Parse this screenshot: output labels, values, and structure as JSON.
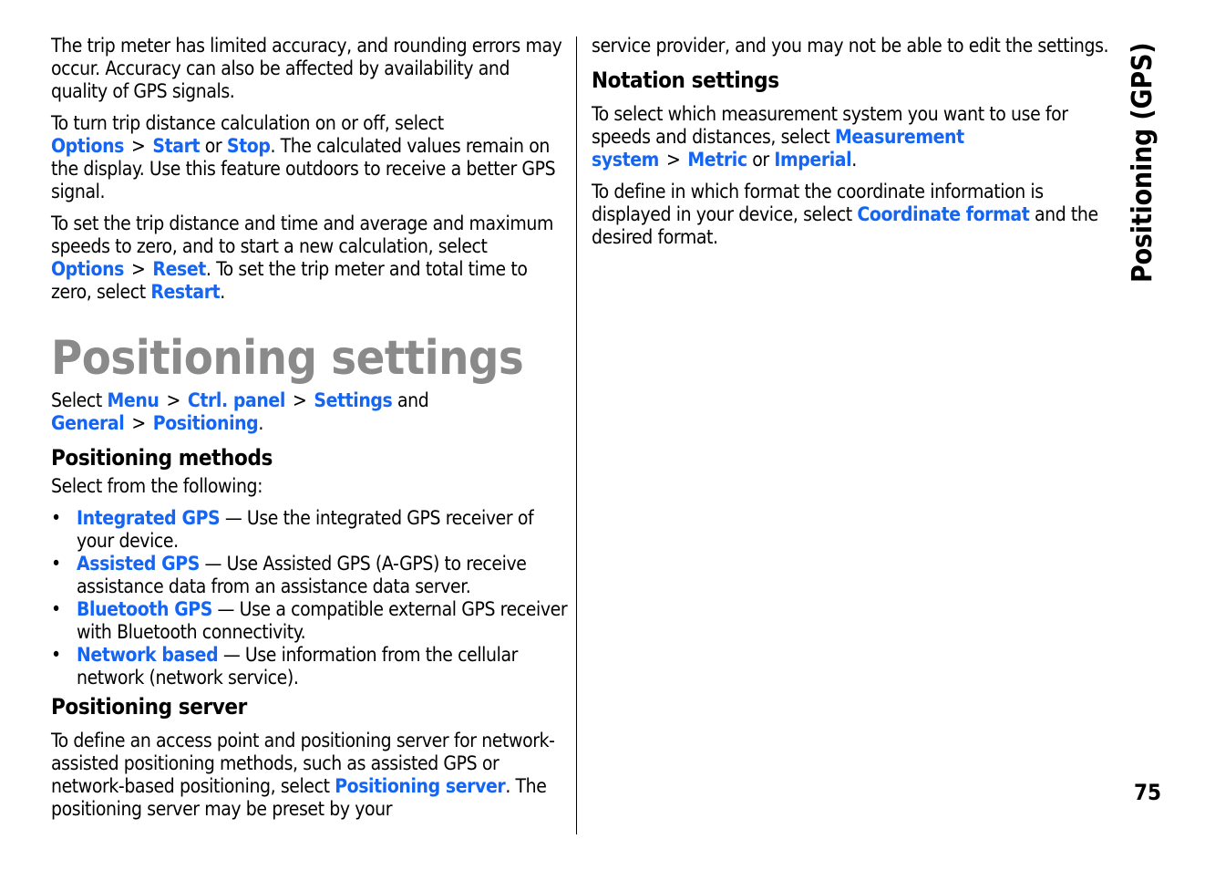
{
  "side_tab": "Positioning (GPS)",
  "page_number": "75",
  "colors": {
    "link": "#1565f5",
    "title": "#8a8a8a"
  },
  "left": {
    "p1": "The trip meter has limited accuracy, and rounding errors may occur. Accuracy can also be affected by availability and quality of GPS signals.",
    "p2": {
      "t1": "To turn trip distance calculation on or off, select ",
      "l1": "Options",
      "sep": ">",
      "l2": "Start",
      "t2": " or ",
      "l3": "Stop",
      "t3": ". The calculated values remain on the display. Use this feature outdoors to receive a better GPS signal."
    },
    "p3": {
      "t1": "To set the trip distance and time and average and maximum speeds to zero, and to start a new calculation, select ",
      "l1": "Options",
      "sep": ">",
      "l2": "Reset",
      "t2": ". To set the trip meter and total time to zero, select ",
      "l3": "Restart",
      "t3": "."
    },
    "title": "Positioning settings",
    "path": {
      "t1": "Select ",
      "l1": "Menu",
      "sep": ">",
      "l2": "Ctrl. panel",
      "l3": "Settings",
      "t2": " and ",
      "l4": "General",
      "l5": "Positioning",
      "t3": "."
    },
    "methods_heading": "Positioning methods",
    "methods_intro": "Select from the following:",
    "bullet": "•",
    "methods": [
      {
        "name": "Integrated GPS",
        "desc": " — Use the integrated GPS receiver of your device."
      },
      {
        "name": "Assisted GPS",
        "desc": " — Use Assisted GPS (A-GPS) to receive assistance data from an assistance data server."
      },
      {
        "name": "Bluetooth GPS",
        "desc": " — Use a compatible external GPS receiver with Bluetooth connectivity."
      },
      {
        "name": "Network based",
        "desc": " — Use information from the cellular network (network service)."
      }
    ],
    "server_heading": "Positioning server",
    "server_p": {
      "t1": "To define an access point and positioning server for network-assisted positioning methods, such as assisted GPS or network-based positioning, select ",
      "l1": "Positioning server",
      "t2": ". The positioning server may be preset by your"
    }
  },
  "right": {
    "p1": "service provider, and you may not be able to edit the settings.",
    "notation_heading": "Notation settings",
    "p2": {
      "t1": "To select which measurement system you want to use for speeds and distances, select ",
      "l1": "Measurement system",
      "sep": ">",
      "l2": "Metric",
      "t2": " or ",
      "l3": "Imperial",
      "t3": "."
    },
    "p3": {
      "t1": "To define in which format the coordinate information is displayed in your device, select ",
      "l1": "Coordinate format",
      "t2": " and the desired format."
    }
  }
}
